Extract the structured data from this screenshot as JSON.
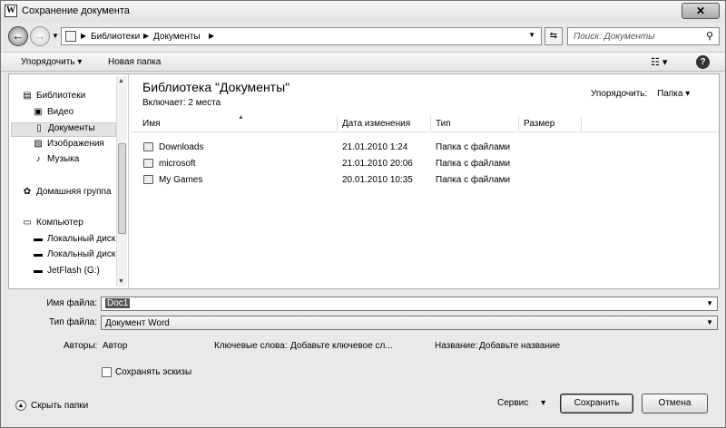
{
  "window": {
    "title": "Сохранение документа",
    "app_icon": "W",
    "close_label": "✕"
  },
  "nav": {
    "address_segments": [
      "Библиотеки",
      "Документы"
    ],
    "search_placeholder": "Поиск: Документы"
  },
  "toolbar": {
    "organize_label": "Упорядочить",
    "new_folder_label": "Новая папка"
  },
  "sidebar": {
    "items": [
      {
        "label": "Библиотеки",
        "icon": "libraries-icon"
      },
      {
        "label": "Видео",
        "icon": "video-icon"
      },
      {
        "label": "Документы",
        "icon": "documents-icon"
      },
      {
        "label": "Изображения",
        "icon": "images-icon"
      },
      {
        "label": "Музыка",
        "icon": "music-icon"
      },
      {
        "label": "Домашняя группа",
        "icon": "homegroup-icon"
      },
      {
        "label": "Компьютер",
        "icon": "computer-icon"
      },
      {
        "label": "Локальный диск",
        "icon": "disk-icon"
      },
      {
        "label": "Локальный диск",
        "icon": "disk-icon"
      },
      {
        "label": "JetFlash (G:)",
        "icon": "usb-drive-icon"
      }
    ]
  },
  "main": {
    "library_title": "Библиотека \"Документы\"",
    "includes": "Включает: 2 места",
    "arrange_label": "Упорядочить:",
    "arrange_value": "Папка",
    "columns": [
      "Имя",
      "Дата изменения",
      "Тип",
      "Размер"
    ],
    "rows": [
      {
        "name": "Downloads",
        "date": "21.01.2010 1:24",
        "type": "Папка с файлами",
        "size": ""
      },
      {
        "name": "microsoft",
        "date": "21.01.2010 20:06",
        "type": "Папка с файлами",
        "size": ""
      },
      {
        "name": "My Games",
        "date": "20.01.2010 10:35",
        "type": "Папка с файлами",
        "size": ""
      }
    ]
  },
  "form": {
    "filename_label": "Имя файла:",
    "filename_value": "Doc1",
    "filetype_label": "Тип файла:",
    "filetype_value": "Документ Word",
    "authors_label": "Авторы:",
    "authors_value": "Автор",
    "keywords_label": "Ключевые слова:",
    "keywords_value": "Добавьте ключевое сл...",
    "title_label": "Название:",
    "title_value": "Добавьте название",
    "save_thumbnails_label": "Сохранять эскизы",
    "save_thumbnails_checked": false
  },
  "footer": {
    "hide_folders_label": "Скрыть папки",
    "service_label": "Сервис",
    "save_label": "Сохранить",
    "cancel_label": "Отмена"
  }
}
